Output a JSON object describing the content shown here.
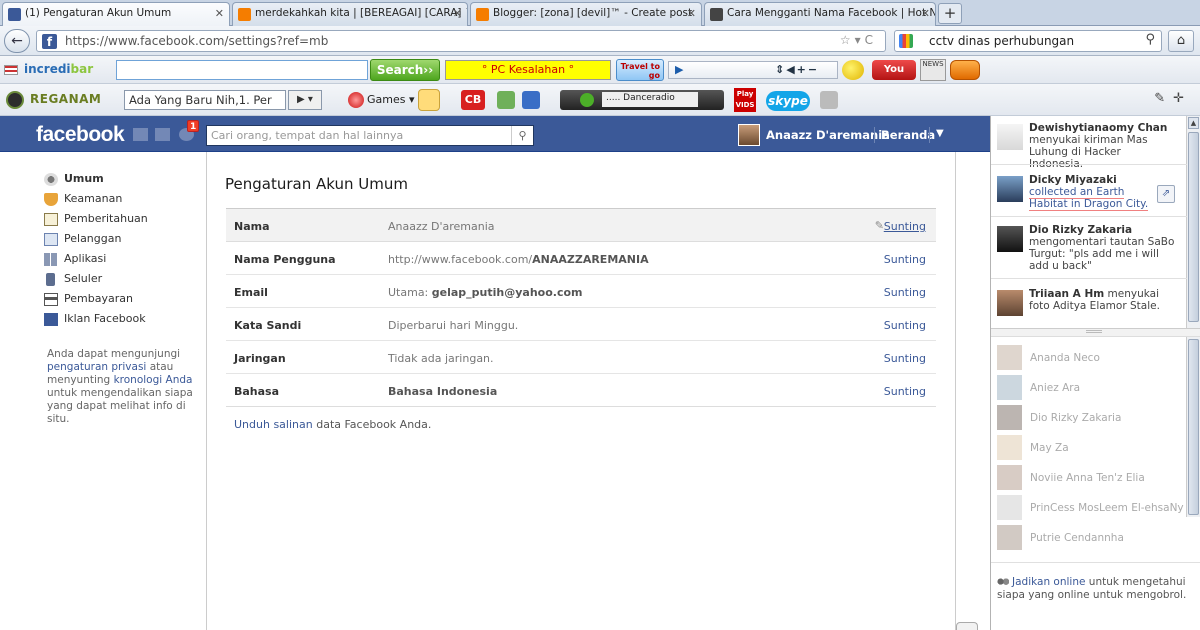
{
  "browser": {
    "tabs": [
      {
        "title": "(1) Pengaturan Akun Umum",
        "icon": "facebook-icon"
      },
      {
        "title": "merdekahkah kita | [BEREAGAI] [CARA] ™",
        "icon": "blogger-icon"
      },
      {
        "title": "Blogger: [zona] [devil]™ - Create post",
        "icon": "blogger-icon"
      },
      {
        "title": "Cara Mengganti Nama Facebook | Hot Ne...",
        "icon": "page-icon"
      }
    ],
    "new_tab_label": "+",
    "url": "https://www.facebook.com/settings?ref=mb",
    "search_query": "cctv dinas perhubungan",
    "back_label": "←",
    "home_label": "⌂"
  },
  "toolbar1": {
    "brand_a": "incredi",
    "brand_b": "bar",
    "search_button": "Search››",
    "yellow_text": "° PC Kesalahan °",
    "travel_text": "Travel to go",
    "youtube": "You Tube",
    "news": "NEWS"
  },
  "toolbar2": {
    "brand": "REGANAM",
    "dropdown_text": "Ada Yang Baru Nih,1. Per",
    "games": "Games",
    "cb": "CB",
    "radio_station": "..... Danceradio",
    "playvids": "Play VIDS",
    "skype": "skype"
  },
  "facebook": {
    "logo": "facebook",
    "notification_count": "1",
    "search_placeholder": "Cari orang, tempat dan hal lainnya",
    "user_name": "Anaazz D'aremania",
    "home_label": "Beranda",
    "colors": {
      "brand": "#3b5998",
      "link": "#3b5998",
      "badge": "#f03d25"
    }
  },
  "leftnav": {
    "items": [
      {
        "label": "Umum",
        "icon": "gears-icon"
      },
      {
        "label": "Keamanan",
        "icon": "shield-icon"
      },
      {
        "label": "Pemberitahuan",
        "icon": "globe-notification-icon"
      },
      {
        "label": "Pelanggan",
        "icon": "subscribers-icon"
      },
      {
        "label": "Aplikasi",
        "icon": "apps-icon"
      },
      {
        "label": "Seluler",
        "icon": "mobile-icon"
      },
      {
        "label": "Pembayaran",
        "icon": "card-icon"
      },
      {
        "label": "Iklan Facebook",
        "icon": "ads-icon"
      }
    ],
    "note_1": "Anda dapat mengunjungi",
    "note_link1": "pengaturan privasi",
    "note_2": "atau menyunting",
    "note_link2": "kronologi Anda",
    "note_3": "untuk mengendalikan siapa yang dapat melihat info di situ."
  },
  "settings": {
    "title": "Pengaturan Akun Umum",
    "rows": [
      {
        "label": "Nama",
        "value": "Anaazz D'aremania",
        "action": "Sunting"
      },
      {
        "label": "Nama Pengguna",
        "value_prefix": "http://www.facebook.com/",
        "value_bold": "ANAAZZAREMANIA",
        "action": "Sunting"
      },
      {
        "label": "Email",
        "value_prefix": "Utama: ",
        "value_bold": "gelap_putih@yahoo.com",
        "action": "Sunting"
      },
      {
        "label": "Kata Sandi",
        "value": "Diperbarui hari Minggu.",
        "action": "Sunting"
      },
      {
        "label": "Jaringan",
        "value": "Tidak ada jaringan.",
        "action": "Sunting"
      },
      {
        "label": "Bahasa",
        "value_bold": "Bahasa Indonesia",
        "action": "Sunting"
      }
    ],
    "download_link": "Unduh salinan",
    "download_text": " data Facebook Anda."
  },
  "ticker": [
    {
      "name": "Dewishytianaomy Chan",
      "text": " menyukai kiriman Mas Luhung di Hacker Indonesia."
    },
    {
      "name": "Dicky Miyazaki",
      "text_hl": " collected an Earth Habitat in Dragon City."
    },
    {
      "name": "Dio Rizky Zakaria",
      "text": " mengomentari tautan SaBo Turgut: \"pls add me i will add u back\""
    },
    {
      "name": "Triiaan A Hm",
      "text": " menyukai foto Aditya Elamor Stale."
    }
  ],
  "chat": {
    "friends": [
      "Ananda Neco",
      "Aniez Ara",
      "Dio Rizky Zakaria",
      "May Za",
      "Noviie Anna Ten'z Elia",
      "PrinCess MosLeem El-ehsaNy",
      "Putrie Cendannha"
    ],
    "online_link": "Jadikan online",
    "online_text": " untuk mengetahui siapa yang online untuk mengobrol."
  }
}
